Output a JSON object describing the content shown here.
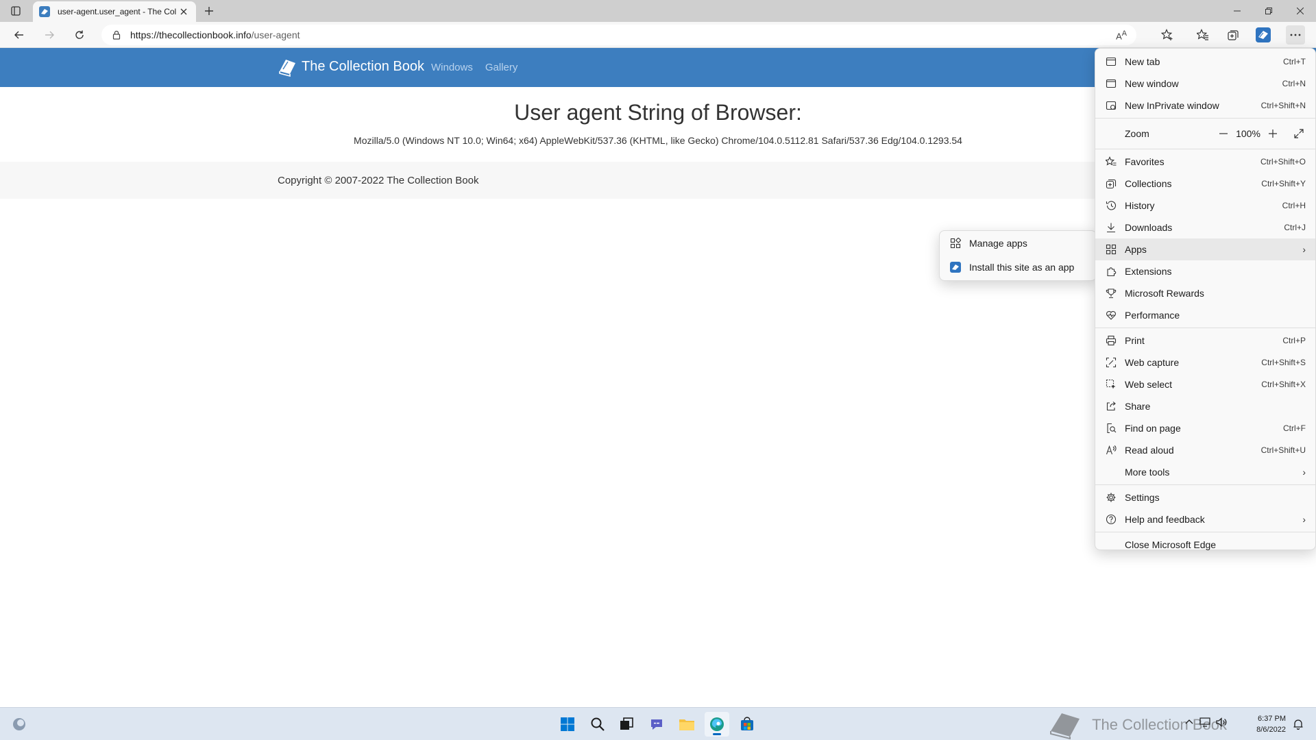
{
  "tab": {
    "title": "user-agent.user_agent - The Coll"
  },
  "addressbar": {
    "url_host": "https://thecollectionbook.info",
    "url_path": "/user-agent"
  },
  "site": {
    "brand_name": "The Collection Book",
    "nav": [
      "Windows",
      "Gallery"
    ],
    "page_title": "User agent String of Browser:",
    "ua_string": "Mozilla/5.0 (Windows NT 10.0; Win64; x64) AppleWebKit/537.36 (KHTML, like Gecko) Chrome/104.0.5112.81 Safari/537.36 Edg/104.0.1293.54",
    "copyright": "Copyright © 2007-2022 The Collection Book"
  },
  "menu": {
    "new_tab": {
      "label": "New tab",
      "shortcut": "Ctrl+T"
    },
    "new_window": {
      "label": "New window",
      "shortcut": "Ctrl+N"
    },
    "new_inprivate": {
      "label": "New InPrivate window",
      "shortcut": "Ctrl+Shift+N"
    },
    "zoom": {
      "label": "Zoom",
      "value": "100%",
      "minus": "—",
      "plus": "+"
    },
    "favorites": {
      "label": "Favorites",
      "shortcut": "Ctrl+Shift+O"
    },
    "collections": {
      "label": "Collections",
      "shortcut": "Ctrl+Shift+Y"
    },
    "history": {
      "label": "History",
      "shortcut": "Ctrl+H"
    },
    "downloads": {
      "label": "Downloads",
      "shortcut": "Ctrl+J"
    },
    "apps": {
      "label": "Apps",
      "chevron": "›"
    },
    "extensions": {
      "label": "Extensions"
    },
    "rewards": {
      "label": "Microsoft Rewards"
    },
    "performance": {
      "label": "Performance"
    },
    "print": {
      "label": "Print",
      "shortcut": "Ctrl+P"
    },
    "web_capture": {
      "label": "Web capture",
      "shortcut": "Ctrl+Shift+S"
    },
    "web_select": {
      "label": "Web select",
      "shortcut": "Ctrl+Shift+X"
    },
    "share": {
      "label": "Share"
    },
    "find": {
      "label": "Find on page",
      "shortcut": "Ctrl+F"
    },
    "read_aloud": {
      "label": "Read aloud",
      "shortcut": "Ctrl+Shift+U"
    },
    "more_tools": {
      "label": "More tools",
      "chevron": "›"
    },
    "settings": {
      "label": "Settings"
    },
    "help": {
      "label": "Help and feedback",
      "chevron": "›"
    },
    "close": {
      "label": "Close Microsoft Edge"
    }
  },
  "apps_submenu": {
    "manage": "Manage apps",
    "install": "Install this site as an app"
  },
  "taskbar": {
    "time": "6:37 PM",
    "date": "8/6/2022",
    "watermark": "The Collection Book"
  },
  "colors": {
    "header_blue": "#3d7ebf",
    "edge_accent": "#0067c0"
  }
}
